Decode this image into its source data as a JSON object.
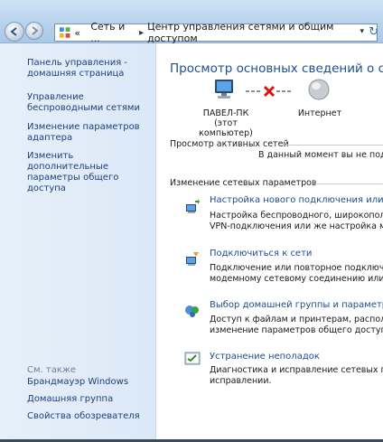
{
  "address": {
    "overflow": "«",
    "crumb1": "Сеть и ...",
    "crumb2": "Центр управления сетями и общим доступом"
  },
  "sidebar": {
    "items": [
      {
        "label": "Панель управления - домашняя страница"
      },
      {
        "label": "Управление беспроводными сетями"
      },
      {
        "label": "Изменение параметров адаптера"
      },
      {
        "label": "Изменить дополнительные параметры общего доступа"
      }
    ],
    "see_also": "См. также",
    "see_also_items": [
      {
        "label": "Брандмауэр Windows"
      },
      {
        "label": "Домашняя группа"
      },
      {
        "label": "Свойства обозревателя"
      }
    ]
  },
  "main": {
    "title": "Просмотр основных сведений о сети и н",
    "computer_name": "ПАВЕЛ-ПК",
    "computer_sub": "(этот компьютер)",
    "internet": "Интернет",
    "active_networks_label": "Просмотр активных сетей",
    "no_connection": "В данный момент вы не подкл",
    "change_settings_label": "Изменение сетевых параметров",
    "tasks": [
      {
        "icon": "new-connection-icon",
        "link": "Настройка нового подключения или сети",
        "desc1": "Настройка беспроводного, широкополос",
        "desc2": "VPN-подключения или же настройка марш"
      },
      {
        "icon": "connect-network-icon",
        "link": "Подключиться к сети",
        "desc1": "Подключение или повторное подключени",
        "desc2": "модемному сетевому соединению или под"
      },
      {
        "icon": "homegroup-icon",
        "link": "Выбор домашней группы и параметров об",
        "desc1": "Доступ к файлам и принтерам, расположе",
        "desc2": "изменение параметров общего доступа."
      },
      {
        "icon": "troubleshoot-icon",
        "link": "Устранение неполадок",
        "desc1": "Диагностика и исправление сетевых пробл",
        "desc2": "исправлении."
      }
    ]
  },
  "colors": {
    "link": "#1e4c8f",
    "sidebar_bg": "#e3eef9",
    "error_x": "#e01010"
  }
}
